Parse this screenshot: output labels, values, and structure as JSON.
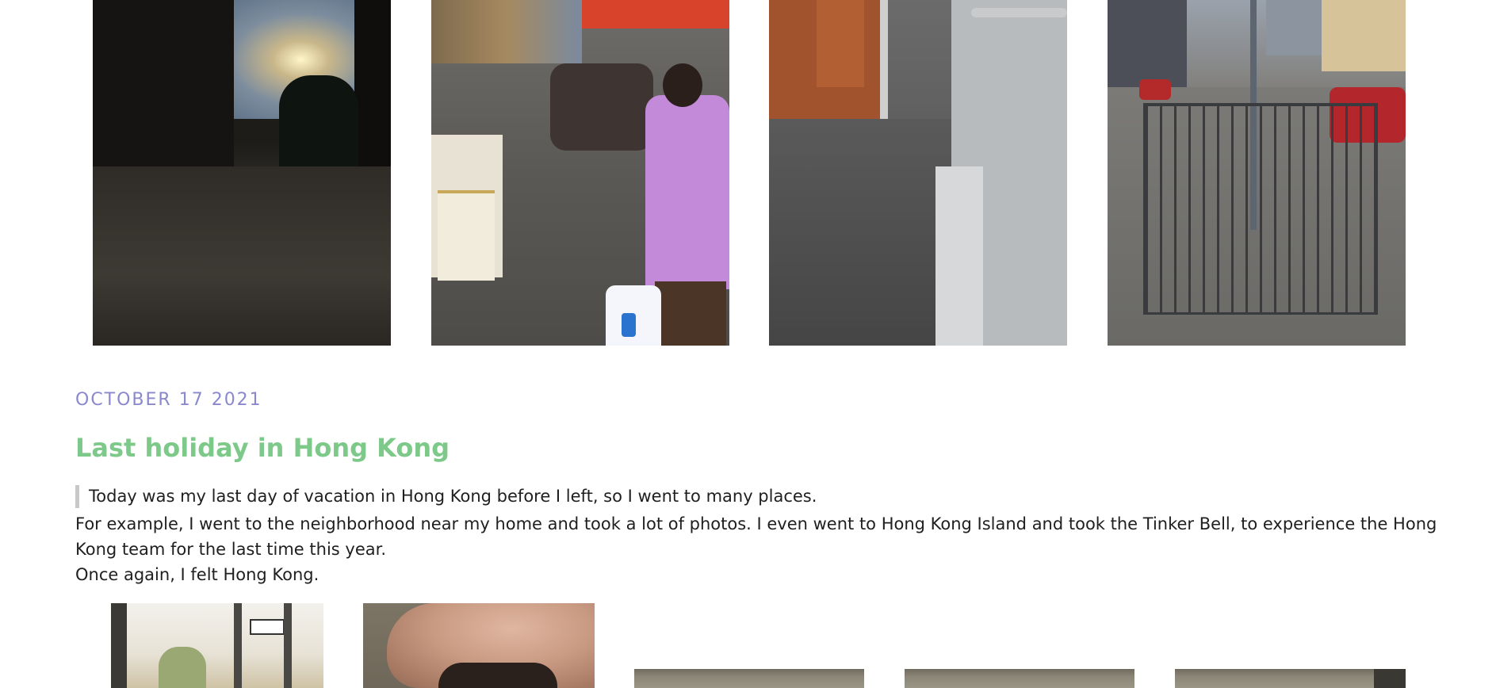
{
  "top_photos": [
    {
      "name": "street-sunset-photo"
    },
    {
      "name": "market-street-photo"
    },
    {
      "name": "tram-interior-photo"
    },
    {
      "name": "road-railing-photo"
    }
  ],
  "post": {
    "date": "OCTOBER 17 2021",
    "title": "Last holiday in Hong Kong",
    "quote": "Today was my last day of vacation in Hong Kong before I left, so I went to many places.",
    "paragraphs": [
      "For example, I went to the neighborhood near my home and took a lot of photos. I even went to Hong Kong Island and took the Tinker Bell, to experience the Hong Kong team for the last time this year.",
      "Once again, I felt Hong Kong."
    ]
  },
  "bottom_photos": [
    {
      "name": "cafe-window-photo"
    },
    {
      "name": "hand-closeup-photo"
    },
    {
      "name": "fabric-photo-1"
    },
    {
      "name": "fabric-photo-2"
    },
    {
      "name": "fabric-photo-3"
    }
  ],
  "colors": {
    "date": "#8a88cc",
    "title": "#7cc98a",
    "quote_border": "#c8c8c8",
    "text": "#1f1f1f"
  }
}
